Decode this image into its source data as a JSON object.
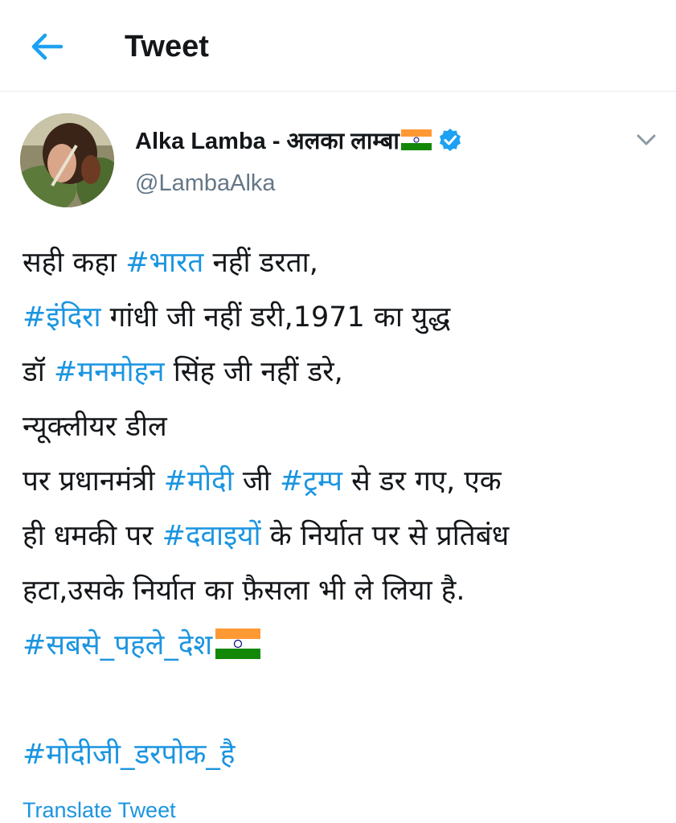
{
  "header": {
    "title": "Tweet",
    "back_icon": "arrow-left-icon",
    "accent_color": "#1da1f2"
  },
  "tweet": {
    "author": {
      "display_name": "Alka Lamba - अलका लाम्बा",
      "handle": "@LambaAlka",
      "verified": true,
      "flag_icon": "india-flag-icon"
    },
    "lines": [
      [
        {
          "t": "सही कहा "
        },
        {
          "h": "#भारत"
        },
        {
          "t": " नहीं डरता,"
        }
      ],
      [
        {
          "h": "#इंदिरा"
        },
        {
          "t": " गांधी जी नहीं डरी,1971 का युद्ध"
        }
      ],
      [
        {
          "t": "डॉ "
        },
        {
          "h": "#मनमोहन"
        },
        {
          "t": " सिंह जी नहीं डरे,"
        }
      ],
      [
        {
          "t": "न्यूक्लीयर डील"
        }
      ],
      [
        {
          "t": "पर प्रधानमंत्री "
        },
        {
          "h": "#मोदी"
        },
        {
          "t": " जी "
        },
        {
          "h": "#ट्रम्प"
        },
        {
          "t": " से डर गए, एक"
        }
      ],
      [
        {
          "t": "ही धमकी पर "
        },
        {
          "h": "#दवाइयों"
        },
        {
          "t": " के निर्यात पर से प्रतिबंध"
        }
      ],
      [
        {
          "t": "हटा,उसके निर्यात का फ़ैसला भी ले लिया है."
        }
      ],
      [
        {
          "h": "#सबसे_पहले_देश"
        },
        {
          "flag": true
        }
      ],
      [],
      [
        {
          "h": "#मोदीजी_डरपोक_है"
        }
      ]
    ],
    "translate_label": "Translate Tweet",
    "hashtag_color": "#1b95e0"
  }
}
